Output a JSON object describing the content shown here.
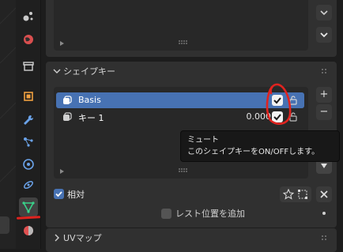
{
  "shape_keys": {
    "header": "シェイプキー",
    "keys": [
      {
        "name": "Basis",
        "value": "",
        "enabled": true,
        "selected": true
      },
      {
        "name": "キー 1",
        "value": "0.000",
        "enabled": true,
        "selected": false
      }
    ],
    "add_label": "+",
    "remove_label": "−",
    "relative_label": "相対",
    "relative_checked": true,
    "rest_position_label": "レスト位置を追加",
    "rest_position_checked": false
  },
  "tooltip": {
    "title": "ミュート",
    "description": "このシェイプキーをON/OFFします。"
  },
  "uv_panel": {
    "header": "UVマップ"
  },
  "colors": {
    "selection": "#4772b3",
    "annotation": "#e0231f",
    "panel": "#303030",
    "list_bg": "#282828"
  },
  "tabs": [
    {
      "icon": "particles-icon"
    },
    {
      "icon": "world-icon"
    },
    {
      "icon": "collection-icon"
    },
    {
      "icon": "object-icon"
    },
    {
      "icon": "modifier-wrench-icon"
    },
    {
      "icon": "particle-system-icon"
    },
    {
      "icon": "physics-icon"
    },
    {
      "icon": "constraint-icon"
    },
    {
      "icon": "mesh-data-icon"
    },
    {
      "icon": "material-icon"
    }
  ]
}
